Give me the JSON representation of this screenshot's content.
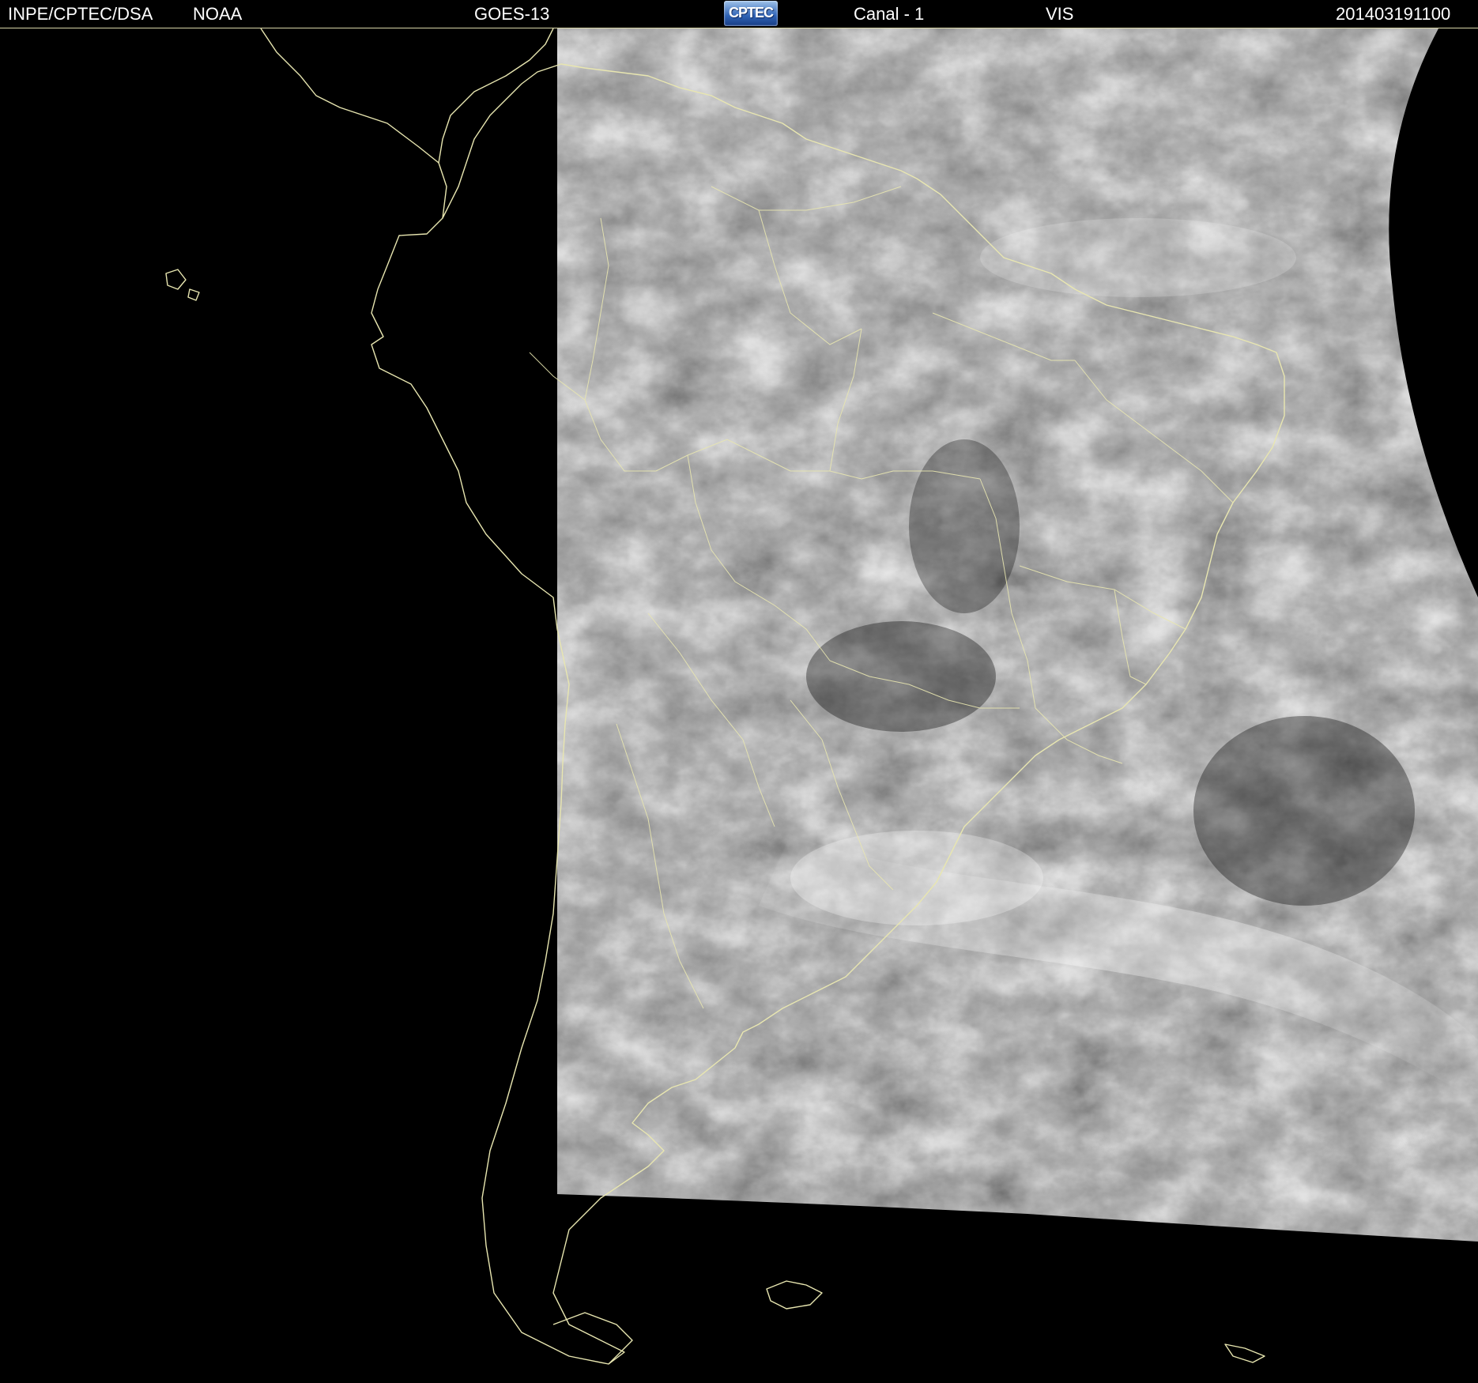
{
  "header": {
    "agency": "INPE/CPTEC/DSA",
    "source": "NOAA",
    "satellite": "GOES-13",
    "logo_text": "CPTEC",
    "channel": "Canal - 1",
    "band": "VIS",
    "timestamp": "201403191100"
  },
  "map": {
    "background_color": "#000000",
    "outline_color": "#e8e6b0",
    "imagery": "visible satellite imagery, grayscale clouds"
  }
}
